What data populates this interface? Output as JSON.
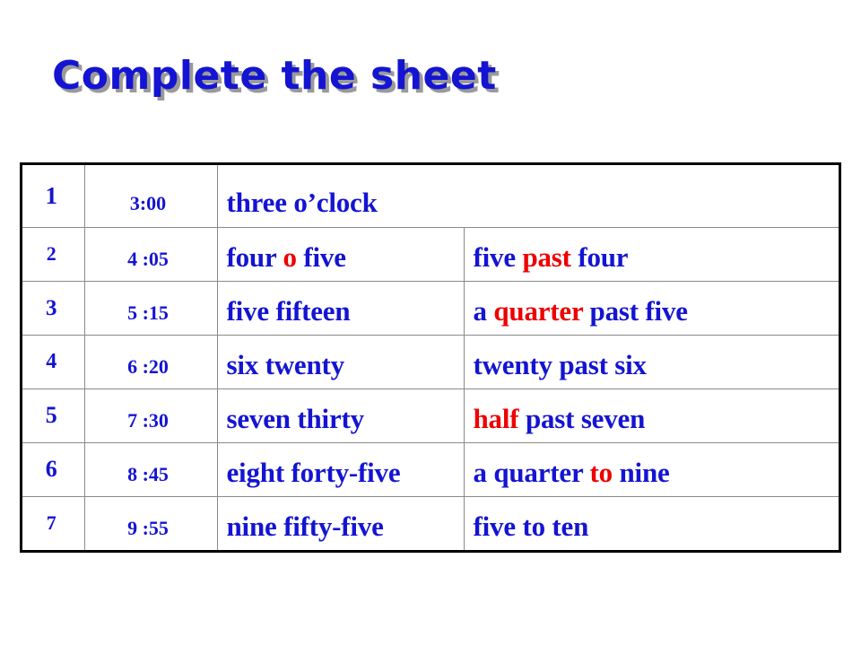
{
  "slide": {
    "title": "Complete the sheet",
    "title_color": "#1414d2",
    "title_shadow_color": "#9a9a9a",
    "text_color": "#1414d2",
    "highlight_color": "#ee0000",
    "border_color": "#000000",
    "grid_color": "#8a8a8a",
    "background": "#ffffff"
  },
  "table": {
    "columns": [
      "number",
      "time",
      "digital_words",
      "analog_words"
    ],
    "rows": [
      {
        "number": "1",
        "time": "3:00",
        "digital": [
          {
            "text": "three o’clock",
            "highlight": false
          }
        ],
        "analog": [],
        "analog_merged": true
      },
      {
        "number": "2",
        "time": "4 :05",
        "digital": [
          {
            "text": "four ",
            "highlight": false
          },
          {
            "text": "o",
            "highlight": true
          },
          {
            "text": " five",
            "highlight": false
          }
        ],
        "analog": [
          {
            "text": "five ",
            "highlight": false
          },
          {
            "text": "past",
            "highlight": true
          },
          {
            "text": " four",
            "highlight": false
          }
        ],
        "analog_merged": false
      },
      {
        "number": "3",
        "time": "5 :15",
        "digital": [
          {
            "text": "five fifteen",
            "highlight": false
          }
        ],
        "analog": [
          {
            "text": "a ",
            "highlight": false
          },
          {
            "text": "quarter",
            "highlight": true
          },
          {
            "text": " past five",
            "highlight": false
          }
        ],
        "analog_merged": false
      },
      {
        "number": "4",
        "time": "6 :20",
        "digital": [
          {
            "text": "six twenty",
            "highlight": false
          }
        ],
        "analog": [
          {
            "text": "twenty past six",
            "highlight": false
          }
        ],
        "analog_merged": false
      },
      {
        "number": "5",
        "time": "7 :30",
        "digital": [
          {
            "text": "seven thirty",
            "highlight": false
          }
        ],
        "analog": [
          {
            "text": "half",
            "highlight": true
          },
          {
            "text": " past seven",
            "highlight": false
          }
        ],
        "analog_merged": false
      },
      {
        "number": "6",
        "time": "8 :45",
        "digital": [
          {
            "text": "eight forty-five",
            "highlight": false
          }
        ],
        "analog": [
          {
            "text": "a quarter ",
            "highlight": false
          },
          {
            "text": "to",
            "highlight": true
          },
          {
            "text": " nine",
            "highlight": false
          }
        ],
        "analog_merged": false
      },
      {
        "number": "7",
        "time": "9 :55",
        "digital": [
          {
            "text": "nine fifty-five",
            "highlight": false
          }
        ],
        "analog": [
          {
            "text": "five to ten",
            "highlight": false
          }
        ],
        "analog_merged": false
      }
    ]
  }
}
